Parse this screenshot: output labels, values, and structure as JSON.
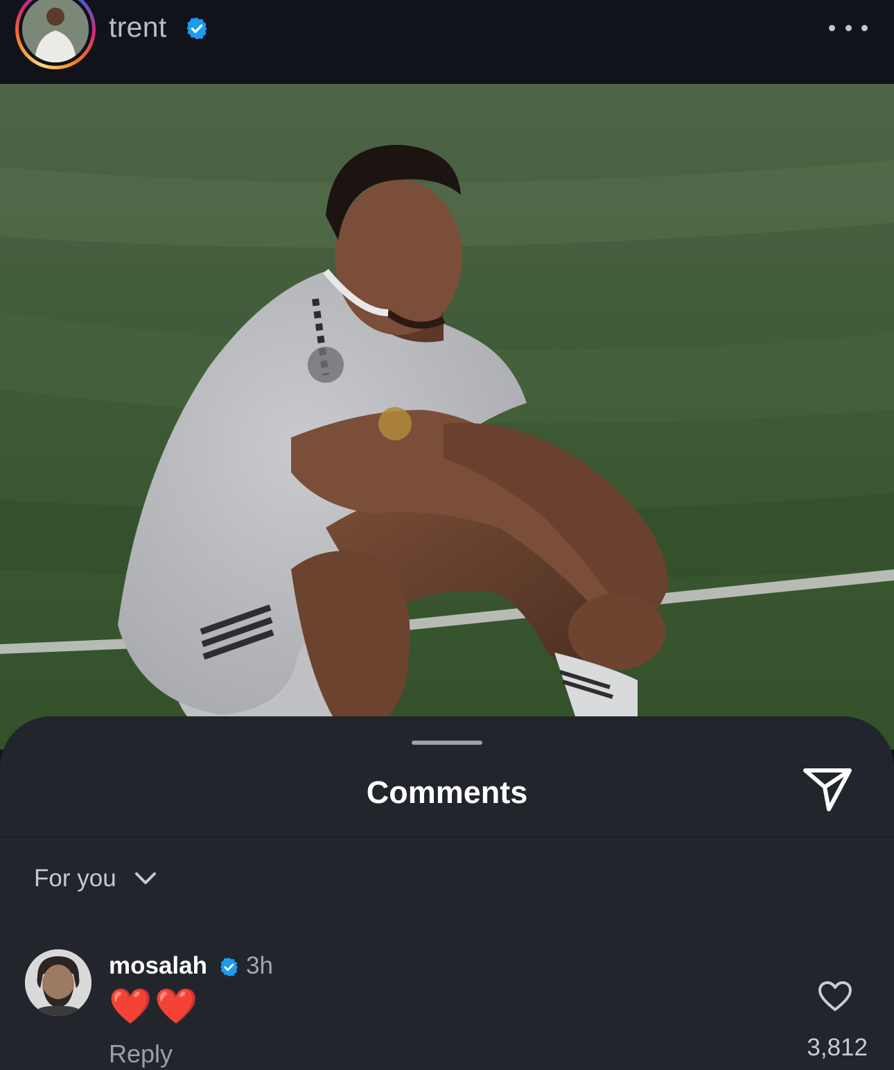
{
  "header": {
    "username": "trent",
    "verified": true,
    "more_icon": "more-horizontal-icon"
  },
  "post": {
    "image_alt": "Player in white kit crouching on a football pitch"
  },
  "comments_sheet": {
    "title": "Comments",
    "share_icon": "paper-plane-icon",
    "filter_label": "For you",
    "filter_icon": "chevron-down-icon",
    "comments": [
      {
        "username": "mosalah",
        "verified": true,
        "time": "3h",
        "text": "❤️❤️",
        "reply_label": "Reply",
        "likes": "3,812",
        "like_icon": "heart-outline-icon"
      }
    ]
  },
  "colors": {
    "verified_blue": "#1d9bf0",
    "sheet_background": "#22252c",
    "header_background": "#10131a"
  }
}
